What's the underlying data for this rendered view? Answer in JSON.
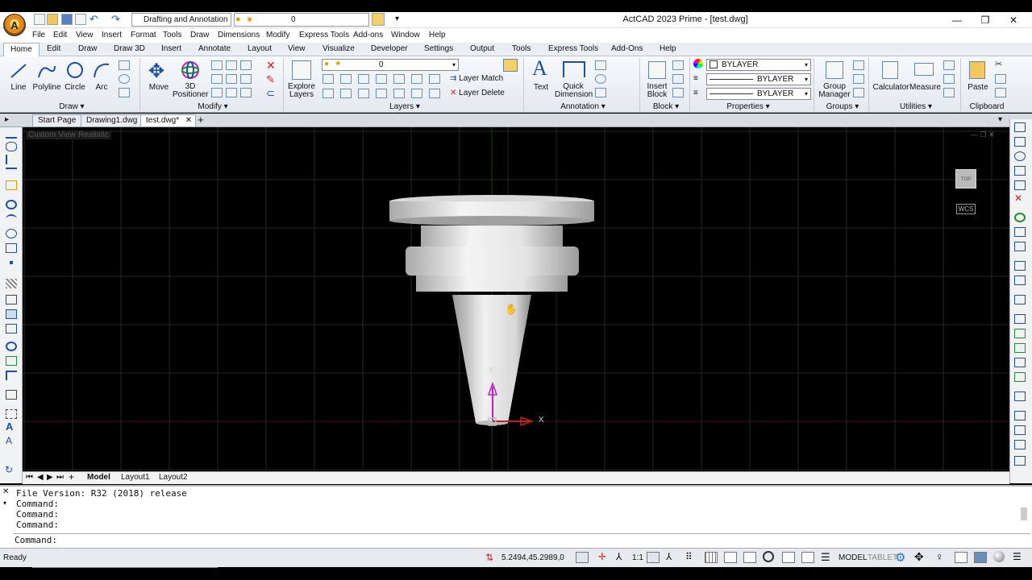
{
  "window": {
    "title": "ActCAD 2023 Prime - [test.dwg]",
    "min": "—",
    "restore": "❐",
    "close": "✕"
  },
  "quick_access": {
    "workspace": "Drafting and Annotation",
    "layer": "0"
  },
  "menu": [
    "File",
    "Edit",
    "View",
    "Insert",
    "Format",
    "Tools",
    "Draw",
    "Dimensions",
    "Modify",
    "Express Tools",
    "Add-ons",
    "Window",
    "Help"
  ],
  "ribbon_tabs": [
    "Home",
    "Edit",
    "Draw",
    "Draw 3D",
    "Insert",
    "Annotate",
    "Layout",
    "View",
    "Visualize",
    "Developer",
    "Settings",
    "Output",
    "Tools",
    "Express Tools",
    "Add-Ons",
    "Help"
  ],
  "ribbon": {
    "draw": {
      "title": "Draw ▾",
      "line": "Line",
      "polyline": "Polyline",
      "circle": "Circle",
      "arc": "Arc"
    },
    "modify": {
      "title": "Modify ▾",
      "move": "Move",
      "positioner_1": "3D",
      "positioner_2": "Positioner"
    },
    "layers": {
      "title": "Layers ▾",
      "explore_1": "Explore",
      "explore_2": "Layers",
      "layer_value": "0",
      "layer_match": "Layer Match",
      "layer_delete": "Layer Delete"
    },
    "annotation": {
      "title": "Annotation ▾",
      "text": "Text",
      "quick_dim_1": "Quick",
      "quick_dim_2": "Dimension"
    },
    "block": {
      "title": "Block ▾",
      "insert_1": "Insert",
      "insert_2": "Block"
    },
    "properties": {
      "title": "Properties ▾",
      "color": "BYLAYER",
      "linetype": "BYLAYER",
      "lineweight": "BYLAYER"
    },
    "groups": {
      "title": "Groups ▾",
      "gm_1": "Group",
      "gm_2": "Manager"
    },
    "utilities": {
      "title": "Utilities ▾",
      "calc": "Calculator",
      "measure": "Measure"
    },
    "clipboard": {
      "title": "Clipboard",
      "paste": "Paste"
    }
  },
  "doc_tabs": [
    "Start Page",
    "Drawing1.dwg",
    "test.dwg*"
  ],
  "viewport": {
    "view": "Custom View",
    "style": "Realistic",
    "cube": "TOP",
    "wcs": "WCS",
    "axis_y": "Y",
    "axis_x": "X"
  },
  "layout_tabs": [
    "Model",
    "Layout1",
    "Layout2"
  ],
  "command": {
    "lines": [
      "File Version: R32 (2018) release",
      "Command:",
      "Command:",
      "Command:"
    ],
    "prompt": "Command:"
  },
  "status": {
    "ready": "Ready",
    "coords": "5.2494,45.2989,0",
    "scale": "1:1",
    "model": "MODEL",
    "tablet": "TABLET"
  },
  "colors": {
    "accent": "#1e6fc7",
    "ribbon_bg": "#eef2f6",
    "viewport": "#000000",
    "axis_y": "#c21fc2",
    "axis_x": "#c22020"
  }
}
